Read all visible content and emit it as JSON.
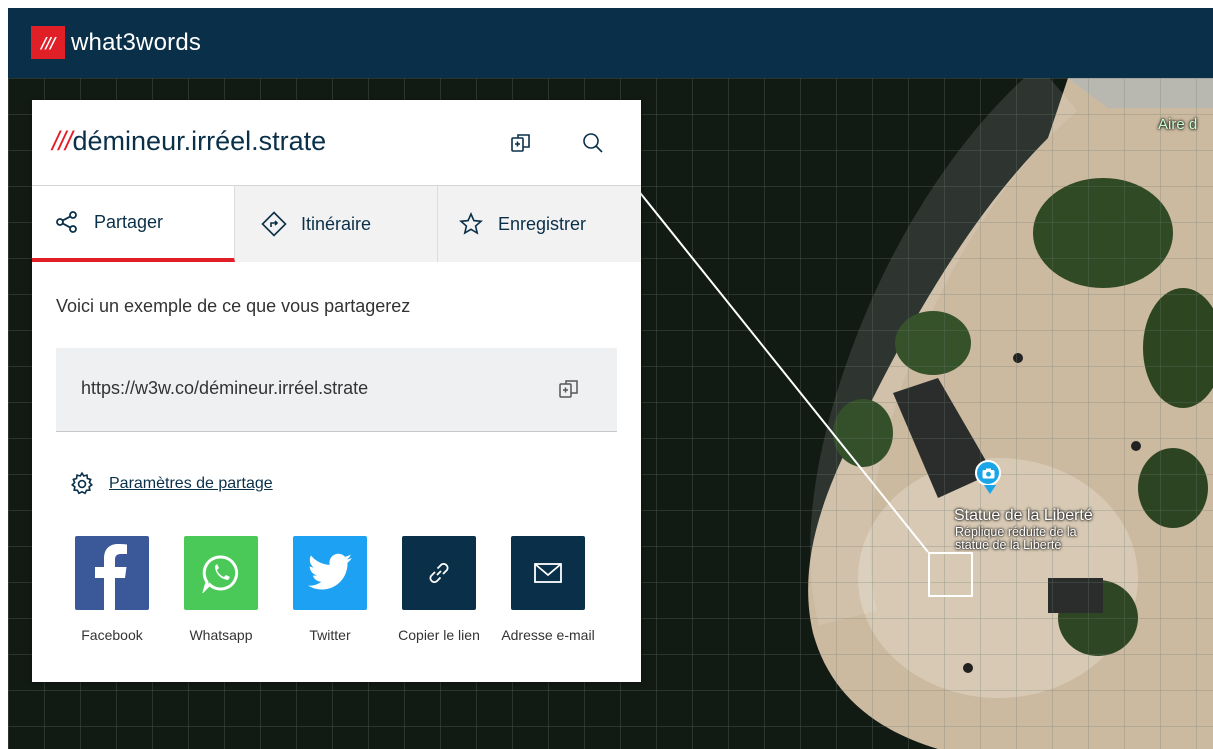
{
  "app": {
    "name": "what3words",
    "logo_mark": "///"
  },
  "colors": {
    "brand_navy": "#0a3049",
    "brand_red": "#e11f26",
    "facebook": "#3b5998",
    "whatsapp": "#4ac959",
    "twitter": "#1da1f2",
    "dark_tile": "#0a3049"
  },
  "panel": {
    "address_slashes": "///",
    "address": "démineur.irréel.strate",
    "tabs": [
      {
        "label": "Partager",
        "icon": "share-icon",
        "active": true
      },
      {
        "label": "Itinéraire",
        "icon": "directions-icon",
        "active": false
      },
      {
        "label": "Enregistrer",
        "icon": "star-icon",
        "active": false
      }
    ],
    "intro": "Voici un exemple de ce que vous partagerez",
    "share_url": "https://w3w.co/démineur.irréel.strate",
    "settings_link": "Paramètres de partage",
    "share_targets": [
      {
        "label": "Facebook",
        "icon": "facebook-icon"
      },
      {
        "label": "Whatsapp",
        "icon": "whatsapp-icon"
      },
      {
        "label": "Twitter",
        "icon": "twitter-icon"
      },
      {
        "label": "Copier le lien",
        "icon": "link-icon"
      },
      {
        "label": "Adresse e-mail",
        "icon": "mail-icon"
      }
    ]
  },
  "map": {
    "poi_top_right": "Aire d",
    "poi_title": "Statue de la Liberté",
    "poi_subtitle": "Réplique réduite de la statue de la Liberté"
  }
}
